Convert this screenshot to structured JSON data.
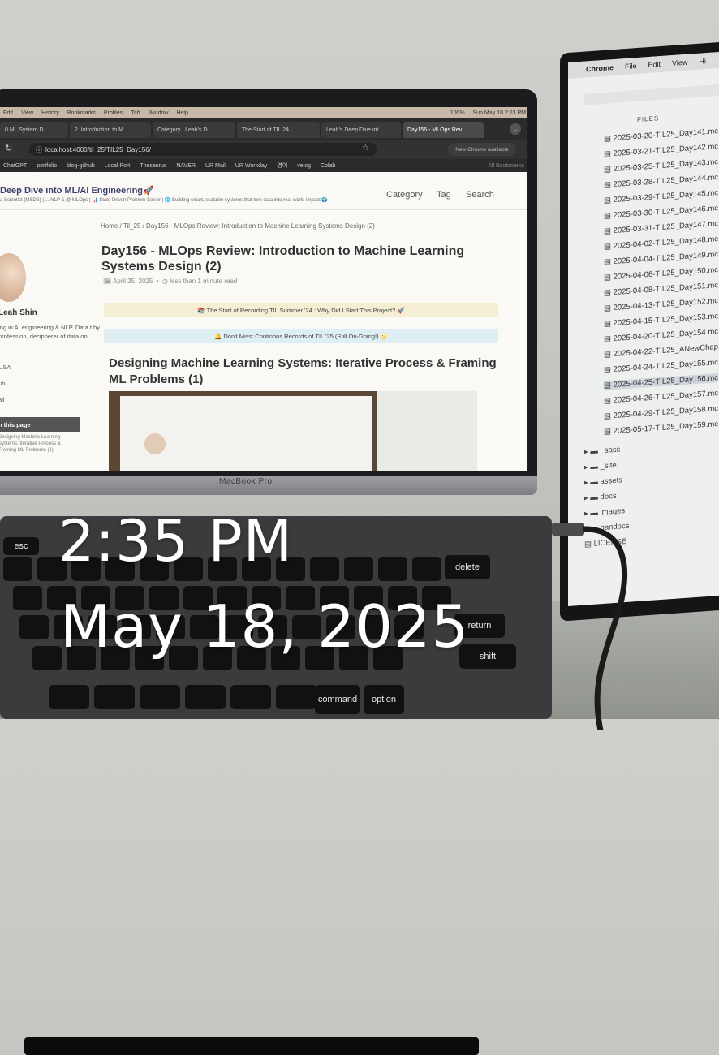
{
  "overlay": {
    "time": "2:35 PM",
    "date": "May 18, 2025"
  },
  "laptop": {
    "brand_label": "MacBook Pro",
    "menubar": {
      "items": [
        "Edit",
        "View",
        "History",
        "Bookmarks",
        "Profiles",
        "Tab",
        "Window",
        "Help"
      ],
      "battery": "100%",
      "datetime": "Sun May 18  2:23 PM"
    },
    "tabs": [
      "0 ML System D",
      "2. Introduction to M",
      "Category | Leah's D",
      "The Start of TIL 24 |",
      "Leah's Deep Dive int",
      "Day156 - MLOps Rev"
    ],
    "url": "localhost:4000/til_25/TIL25_Day156/",
    "new_chrome": "New Chrome available",
    "bookmarks": [
      "ChatGPT",
      "portfolio",
      "blog-github",
      "Local Port",
      "Thesaurus",
      "NAVER",
      "UR Mail",
      "UR Workday",
      "영어",
      "velog",
      "Colab"
    ],
    "all_bookmarks": "All Bookmarks",
    "site": {
      "title": "Deep Dive into ML/AI Engineering🚀",
      "subtitle": "a Scientist (MSDS) | ... NLP & @ MLOps | 📊 Stats-Driven Problem Solver | 🌐 Building smart, scalable systems that turn data into real-world impact 🌍",
      "nav": [
        "Category",
        "Tag",
        "Search"
      ]
    },
    "sidebar": {
      "author": "Leah Shin",
      "bio": "ing in AI engineering & NLP. Data t by profession, decipherer of data on.",
      "links": [
        "USA",
        "ub",
        "ail"
      ],
      "on_this_page": "n this page",
      "toc": "Designing Machine Learning Systems: Iterative Process & Framing ML Problems (1)"
    },
    "post": {
      "breadcrumb": "Home / Til_25 / Day156 - MLOps Review: Introduction to Machine Learning Systems Design (2)",
      "title": "Day156 - MLOps Review: Introduction to Machine Learning Systems Design (2)",
      "date": "April 25, 2025",
      "read_time": "less than 1 minute read",
      "notice1": "📚 The Start of Recording TIL Summer '24 : Why Did I Start This Project? 🚀",
      "notice2": "🔔 Don't Miss: Continous Records of TIL '25 (Still On-Going!) 🌝",
      "heading": "Designing Machine Learning Systems: Iterative Process & Framing ML Problems (1)"
    },
    "keyboard": {
      "row_labels": [
        "esc",
        "delete",
        "return",
        "shift",
        "option",
        "command"
      ]
    }
  },
  "monitor": {
    "menubar": [
      "Chrome",
      "File",
      "Edit",
      "View",
      "Hi"
    ],
    "files_title": "FILES",
    "files": [
      "2025-03-20-TIL25_Day141.mc",
      "2025-03-21-TIL25_Day142.mc",
      "2025-03-25-TIL25_Day143.mc",
      "2025-03-28-TIL25_Day144.mc",
      "2025-03-29-TIL25_Day145.mc",
      "2025-03-30-TIL25_Day146.mc",
      "2025-03-31-TIL25_Day147.mc",
      "2025-04-02-TIL25_Day148.mc",
      "2025-04-04-TIL25_Day149.mc",
      "2025-04-06-TIL25_Day150.mc",
      "2025-04-08-TIL25_Day151.mc",
      "2025-04-13-TIL25_Day152.mc",
      "2025-04-15-TIL25_Day153.mc",
      "2025-04-20-TIL25_Day154.mc",
      "2025-04-22-TIL25_ANewChap",
      "2025-04-24-TIL25_Day155.mc",
      "2025-04-25-TIL25_Day156.mc",
      "2025-04-26-TIL25_Day157.mc",
      "2025-04-29-TIL25_Day158.mc",
      "2025-05-17-TIL25_Day159.mc"
    ],
    "folders": [
      "_sass",
      "_site",
      "assets",
      "docs",
      "images",
      "pandocs"
    ],
    "extra": [
      "LICENSE"
    ]
  }
}
